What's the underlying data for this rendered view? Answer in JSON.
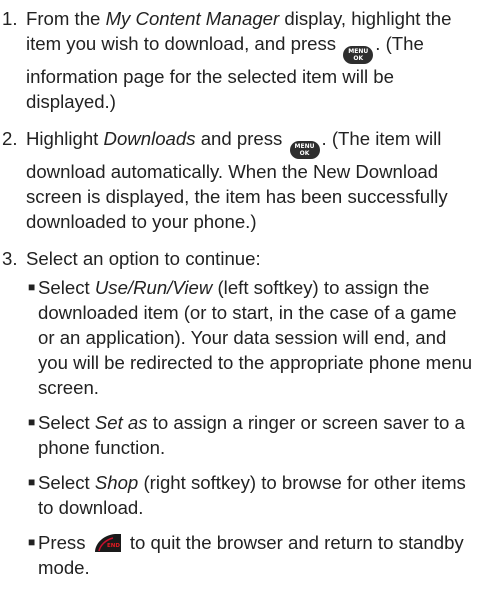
{
  "steps": [
    {
      "num": "1.",
      "a": "From the ",
      "em1": "My Content Manager",
      "b": " display, highlight the item you wish to download, and press ",
      "c": ". (The information page for the selected item will be displayed.)"
    },
    {
      "num": "2.",
      "a": "Highlight ",
      "em1": "Downloads",
      "b": " and press ",
      "c": ". (The item will download automatically. When the New Download screen is displayed, the item has been successfully downloaded to your phone.)"
    },
    {
      "num": "3.",
      "a": "Select an option to continue:"
    }
  ],
  "bullets": [
    {
      "a": "Select ",
      "em": "Use/Run/View",
      "b": " (left softkey) to assign the downloaded item (or to start, in the case of a game or an application). Your data session will end, and you will be redirected to the appropriate phone menu screen."
    },
    {
      "a": "Select ",
      "em": "Set as",
      "b": " to assign a ringer or screen saver to a phone function."
    },
    {
      "a": "Select ",
      "em": "Shop",
      "b": " (right softkey) to browse for other items to download."
    },
    {
      "a": "Press ",
      "b": " to quit the browser and return to standby mode."
    }
  ],
  "keys": {
    "menu_top": "MENU",
    "menu_bottom": "OK",
    "end": "END"
  },
  "colors": {
    "text": "#222222",
    "key_fill": "#2e2e2e",
    "end_key_fill": "#1a1a1a"
  }
}
